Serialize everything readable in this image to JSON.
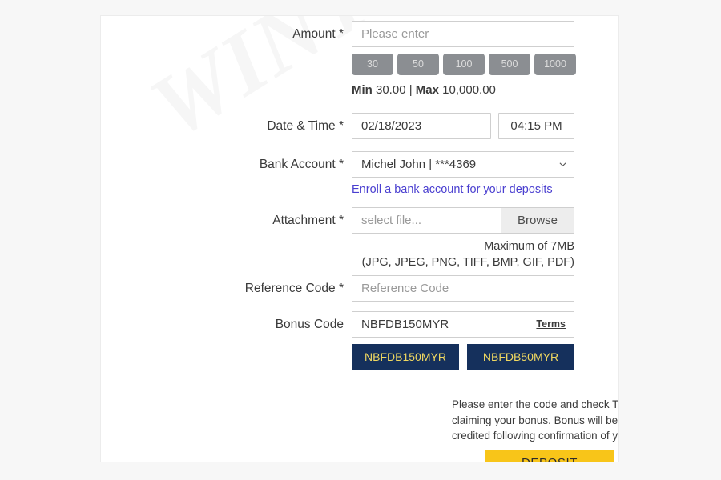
{
  "watermark": {
    "text": "WINTE"
  },
  "form": {
    "amount": {
      "label": "Amount",
      "required_mark": "*",
      "placeholder": "Please enter",
      "value": "",
      "quick_amounts": [
        "30",
        "50",
        "100",
        "500",
        "1000"
      ],
      "min_label": "Min",
      "min_value": "30.00",
      "separator": "|",
      "max_label": "Max",
      "max_value": "10,000.00"
    },
    "datetime": {
      "label": "Date & Time",
      "required_mark": "*",
      "date_value": "02/18/2023",
      "time_value": "04:15 PM"
    },
    "bank_account": {
      "label": "Bank Account",
      "required_mark": "*",
      "selected": "Michel John | ***4369",
      "enroll_link": "Enroll a bank account for your deposits"
    },
    "attachment": {
      "label": "Attachment",
      "required_mark": "*",
      "file_placeholder": "select file...",
      "browse_label": "Browse",
      "note_line1": "Maximum of 7MB",
      "note_line2": "(JPG, JPEG, PNG, TIFF, BMP, GIF, PDF)"
    },
    "reference_code": {
      "label": "Reference Code",
      "required_mark": "*",
      "placeholder": "Reference Code",
      "value": ""
    },
    "bonus_code": {
      "label": "Bonus Code",
      "required_mark": "",
      "value": "NBFDB150MYR",
      "terms_label": "Terms",
      "options": [
        "NBFDB150MYR",
        "NBFDB50MYR"
      ],
      "note": "Please enter the code and check T&Cs before claiming your bonus. Bonus will be immediately credited following confirmation of your deposit"
    },
    "submit": {
      "label": "DEPOSIT"
    }
  },
  "colors": {
    "page_background": "#f7f7f7",
    "card_background": "#ffffff",
    "quick_button": "#8b8e92",
    "bonus_button": "#15305c",
    "bonus_button_text": "#f0d860",
    "deposit_button": "#f8c519",
    "link": "#4a3fd0",
    "text": "#3b3b3b"
  }
}
